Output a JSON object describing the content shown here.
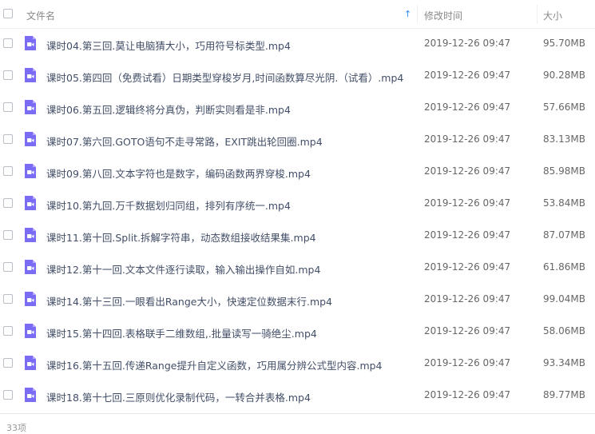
{
  "header": {
    "name_label": "文件名",
    "sort_indicator": "↑",
    "time_label": "修改时间",
    "size_label": "大小"
  },
  "files": [
    {
      "name": "课时04.第三回.莫让电脑猜大小，巧用符号标类型.mp4",
      "time": "2019-12-26 09:47",
      "size": "95.70MB"
    },
    {
      "name": "课时05.第四回（免费试看）日期类型穿梭岁月,时间函数算尽光阴.（试看）.mp4",
      "time": "2019-12-26 09:47",
      "size": "90.28MB"
    },
    {
      "name": "课时06.第五回.逻辑终将分真伪，判断实则看是非.mp4",
      "time": "2019-12-26 09:47",
      "size": "57.66MB"
    },
    {
      "name": "课时07.第六回.GOTO语句不走寻常路，EXIT跳出轮回圈.mp4",
      "time": "2019-12-26 09:47",
      "size": "83.13MB"
    },
    {
      "name": "课时09.第八回.文本字符也是数字，编码函数两界穿梭.mp4",
      "time": "2019-12-26 09:47",
      "size": "85.98MB"
    },
    {
      "name": "课时10.第九回.万千数据划归同组，排列有序统一.mp4",
      "time": "2019-12-26 09:47",
      "size": "53.84MB"
    },
    {
      "name": "课时11.第十回.Split.拆解字符串，动态数组接收结果集.mp4",
      "time": "2019-12-26 09:47",
      "size": "87.07MB"
    },
    {
      "name": "课时12.第十一回.文本文件逐行读取，输入输出操作自如.mp4",
      "time": "2019-12-26 09:47",
      "size": "61.86MB"
    },
    {
      "name": "课时14.第十三回.一眼看出Range大小，快速定位数据末行.mp4",
      "time": "2019-12-26 09:47",
      "size": "99.04MB"
    },
    {
      "name": "课时15.第十四回.表格联手二维数组,.批量读写一骑绝尘.mp4",
      "time": "2019-12-26 09:47",
      "size": "58.06MB"
    },
    {
      "name": "课时16.第十五回.传递Range提升自定义函数，巧用属分辨公式型内容.mp4",
      "time": "2019-12-26 09:47",
      "size": "93.34MB"
    },
    {
      "name": "课时18.第十七回.三原则优化录制代码，一转合并表格.mp4",
      "time": "2019-12-26 09:47",
      "size": "89.77MB"
    }
  ],
  "footer": {
    "count": "33项"
  },
  "colors": {
    "icon_purple": "#7b6cf6",
    "sort_blue": "#2a8bf2"
  },
  "icons": {
    "file_type": "video-file-icon",
    "sort": "sort-ascending-icon"
  }
}
